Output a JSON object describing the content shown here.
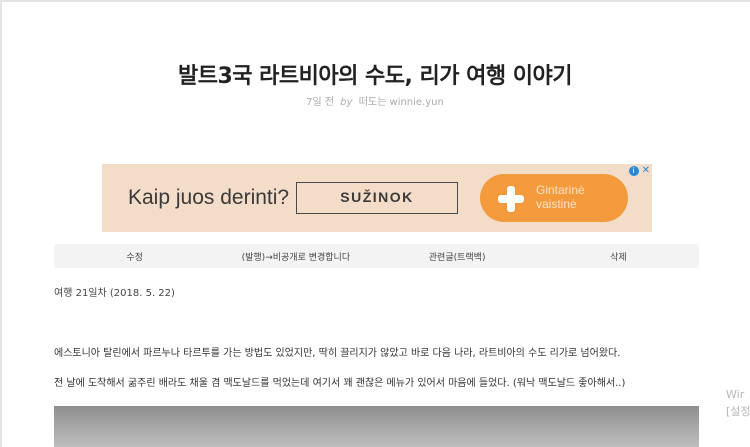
{
  "post": {
    "title": "발트3국 라트비아의 수도, 리가 여행 이야기",
    "meta_time": "7일 전",
    "meta_by": "by",
    "meta_author": "떠도는 winnie.yun"
  },
  "ad": {
    "headline": "Kaip juos derinti?",
    "button_label": "SUŽINOK",
    "brand_line1": "Gintarinė",
    "brand_line2": "vaistinė",
    "choices_info": "i",
    "choices_close": "✕",
    "bg_color": "#f3dcc8",
    "brand_color": "#f29a3c"
  },
  "actions": {
    "edit": "수정",
    "private": "(발행)→비공개로 변경합니다",
    "trackback": "관련글(트랙백)",
    "delete": "삭제"
  },
  "content": {
    "date_line": "여행 21일차 (2018. 5. 22)",
    "paragraph1": "에스토니아 탈린에서 파르누나 타르투를 가는 방법도 있었지만, 딱히 끌리지가 않았고 바로 다음 나라, 라트비아의 수도 리가로 넘어왔다.",
    "paragraph2": "전 날에 도착해서 굶주린 배라도 채울 겸 맥도날드를 먹었는데 여기서 꽤 괜찮은 메뉴가 있어서 마음에 들었다. (워낙 맥도날드 좋아해서..)"
  },
  "watermark": {
    "line1": "Wir",
    "line2": "[설정"
  }
}
